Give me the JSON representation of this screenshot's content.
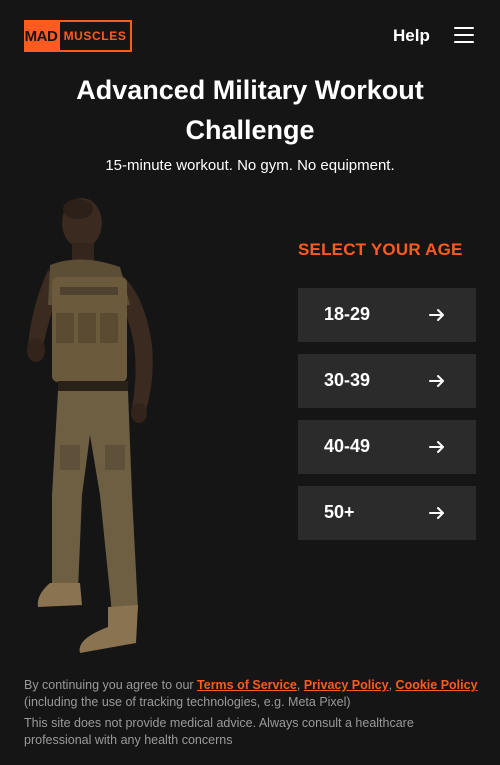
{
  "header": {
    "logo_mad": "MAD",
    "logo_muscles": "MUSCLES",
    "help_label": "Help"
  },
  "hero": {
    "title": "Advanced Military Workout Challenge",
    "subtitle": "15-minute workout. No gym. No equipment."
  },
  "age_selector": {
    "heading": "SELECT YOUR AGE",
    "options": [
      {
        "label": "18-29"
      },
      {
        "label": "30-39"
      },
      {
        "label": "40-49"
      },
      {
        "label": "50+"
      }
    ]
  },
  "footer": {
    "agree_prefix": "By continuing you agree to our ",
    "terms": "Terms of Service",
    "sep1": ", ",
    "privacy": "Privacy Policy",
    "sep2": ", ",
    "cookie": "Cookie Policy",
    "tracking_note": "(including the use of tracking technologies, e.g. Meta Pixel)",
    "disclaimer": "This site does not provide medical advice. Always consult a healthcare professional with any health concerns"
  },
  "colors": {
    "background": "#151515",
    "accent": "#ff5a1f",
    "button_bg": "#2b2b2b",
    "muted_text": "#9a9a9a"
  },
  "icons": [
    "menu-icon",
    "arrow-right-icon"
  ]
}
